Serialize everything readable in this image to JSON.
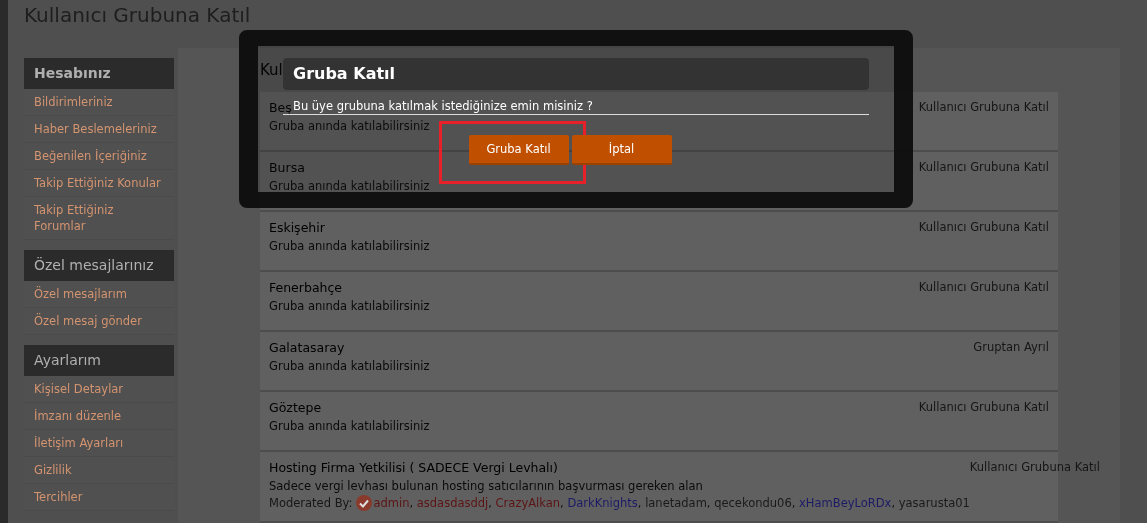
{
  "page_title": "Kullanıcı Grubuna Katıl",
  "sidebar": [
    {
      "heading": "Hesabınız",
      "items": [
        "Bildirimleriniz",
        "Haber Beslemeleriniz",
        "Beğenilen İçeriğiniz",
        "Takip Ettiğiniz Konular",
        "Takip Ettiğiniz Forumlar"
      ]
    },
    {
      "heading": "Özel mesajlarınız",
      "items": [
        "Özel mesajlarım",
        "Özel mesaj gönder"
      ]
    },
    {
      "heading": "Ayarlarım",
      "items": [
        "Kişisel Detaylar",
        "İmzanı düzenle",
        "İletişim Ayarları",
        "Gizlilik",
        "Tercihler"
      ]
    }
  ],
  "panel_heading": "Kul",
  "groups": [
    {
      "title": "Beş",
      "description": "Gruba anında katılabilirsiniz",
      "action": "Kullanıcı Grubuna Katıl"
    },
    {
      "title": "Bursa",
      "description": "Gruba anında katılabilirsiniz",
      "action": "Kullanıcı Grubuna Katıl"
    },
    {
      "title": "Eskişehir",
      "description": "Gruba anında katılabilirsiniz",
      "action": "Kullanıcı Grubuna Katıl"
    },
    {
      "title": "Fenerbahçe",
      "description": "Gruba anında katılabilirsiniz",
      "action": "Kullanıcı Grubuna Katıl"
    },
    {
      "title": "Galatasaray",
      "description": "Gruba anında katılabilirsiniz",
      "action": "Gruptan Ayrıl"
    },
    {
      "title": "Göztepe",
      "description": "Gruba anında katılabilirsiniz",
      "action": "Kullanıcı Grubuna Katıl"
    },
    {
      "title": "Hosting Firma Yetkilisi ( SADECE Vergi Levhalı)",
      "description": "Sadece vergi levhası bulunan hosting satıcılarının başvurması gereken alan",
      "action": "Kullanıcı Grubuna Katıl",
      "moderated_label": "Moderated By:",
      "moderator_separator": ",",
      "moderators": [
        {
          "name": "admin",
          "color": "#5c1414"
        },
        {
          "name": "asdasdasddj",
          "color": "#5c1414"
        },
        {
          "name": "CrazyAlkan",
          "color": "#5c1414"
        },
        {
          "name": "DarkKnights",
          "color": "#1c1c66"
        },
        {
          "name": "lanetadam",
          "color": "#1a1a1a"
        },
        {
          "name": "qecekondu06",
          "color": "#1a1a1a"
        },
        {
          "name": "xHamBeyLoRDx",
          "color": "#1c1c66"
        },
        {
          "name": "yasarusta01",
          "color": "#1a1a1a"
        }
      ]
    }
  ],
  "modal": {
    "title": "Gruba Katıl",
    "message": "Bu üye grubuna katılmak istediğinize emin misiniz ?",
    "buttons": [
      {
        "label": "Gruba Katıl",
        "highlighted": true
      },
      {
        "label": "İptal",
        "highlighted": false
      }
    ]
  }
}
